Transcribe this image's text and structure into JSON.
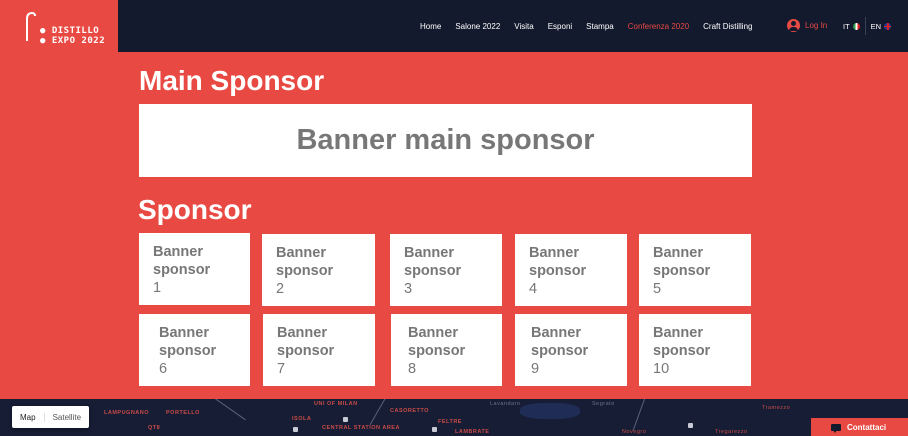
{
  "brand": {
    "line1": "DISTILLO",
    "line2": "EXPO 2022"
  },
  "nav": {
    "items": [
      {
        "label": "Home"
      },
      {
        "label": "Salone 2022"
      },
      {
        "label": "Visita"
      },
      {
        "label": "Esponi"
      },
      {
        "label": "Stampa"
      },
      {
        "label": "Conferenza 2020",
        "active": true
      },
      {
        "label": "Craft Distilling"
      }
    ],
    "login_label": "Log In",
    "languages": [
      "IT",
      "EN"
    ]
  },
  "main": {
    "main_sponsor_title": "Main Sponsor",
    "main_banner": "Banner main sponsor",
    "sponsor_title": "Sponsor",
    "sponsors": [
      {
        "name": "Banner sponsor",
        "num": "1"
      },
      {
        "name": "Banner sponsor",
        "num": "2"
      },
      {
        "name": "Banner sponsor",
        "num": "3"
      },
      {
        "name": "Banner sponsor",
        "num": "4"
      },
      {
        "name": "Banner sponsor",
        "num": "5"
      },
      {
        "name": "Banner sponsor",
        "num": "6"
      },
      {
        "name": "Banner sponsor",
        "num": "7"
      },
      {
        "name": "Banner sponsor",
        "num": "8"
      },
      {
        "name": "Banner sponsor",
        "num": "9"
      },
      {
        "name": "Banner sponsor",
        "num": "10"
      }
    ]
  },
  "map": {
    "toggle": [
      "Map",
      "Satellite"
    ],
    "labels": [
      "LAMPUGNANO",
      "PORTELLO",
      "QT8",
      "ISOLA",
      "UNI OF MILAN",
      "CENTRAL STATION AREA",
      "CASORETTO",
      "FELTRE",
      "LAMBRATE",
      "Lavandaro",
      "Segrate",
      "Novegro",
      "Tregarezzo",
      "Tramezzo"
    ]
  },
  "contact_label": "Contattaci",
  "colors": {
    "accent": "#e84a43",
    "nav_bg": "#131a2d",
    "banner_text": "#777777"
  }
}
